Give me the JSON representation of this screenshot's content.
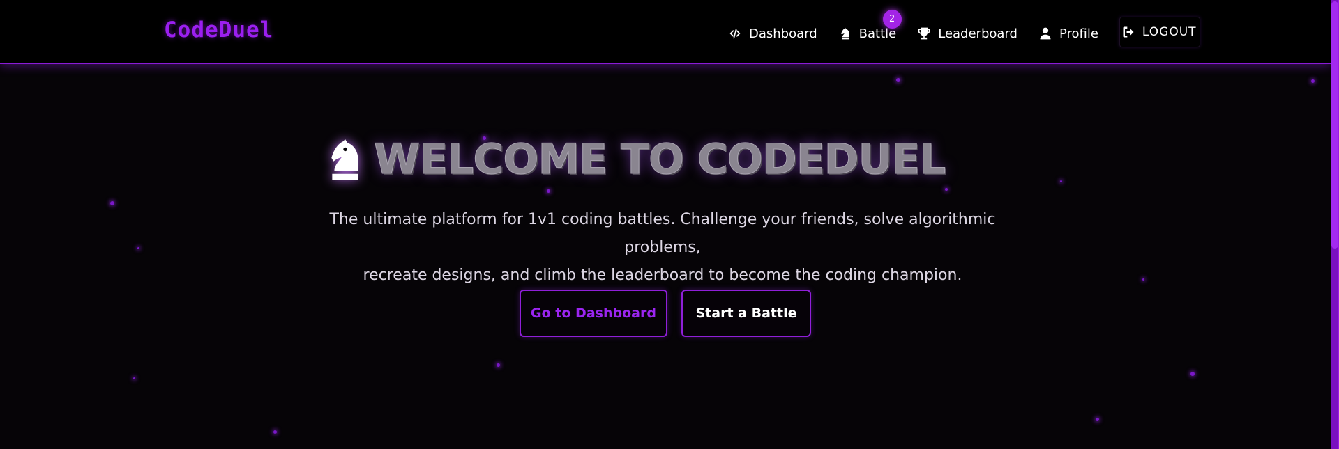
{
  "navbar": {
    "brand": "CodeDuel",
    "links": [
      {
        "label": "Dashboard",
        "icon": "code-icon"
      },
      {
        "label": "Battle",
        "icon": "chess-knight-icon",
        "badge": "2"
      },
      {
        "label": "Leaderboard",
        "icon": "trophy-icon"
      },
      {
        "label": "Profile",
        "icon": "user-icon"
      },
      {
        "label": "LOGOUT",
        "icon": "sign-out-icon"
      }
    ]
  },
  "hero": {
    "title": "WELCOME TO CODEDUEL",
    "title_icon": "chess-knight-icon",
    "subtitle_line1": "The ultimate platform for 1v1 coding battles. Challenge your friends, solve algorithmic problems,",
    "subtitle_line2": "recreate designs, and climb the leaderboard to become the coding champion.",
    "primary_button": "Go to Dashboard",
    "secondary_button": "Start a Battle"
  },
  "colors": {
    "accent": "#9b1ff0",
    "background": "#060407",
    "navbar": "#000000",
    "badge": "#a324e6"
  }
}
